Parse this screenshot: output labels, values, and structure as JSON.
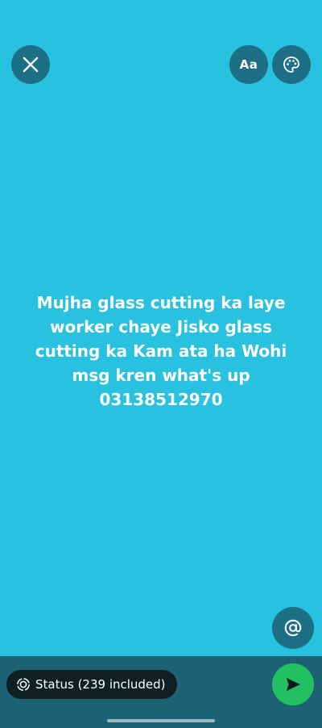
{
  "toolbar": {
    "close_icon": "close-icon",
    "font_button_label": "Aa",
    "palette_icon": "palette-icon"
  },
  "status": {
    "text": "Mujha glass cutting ka laye\nworker chaye Jisko glass\ncutting ka Kam ata ha Wohi\nmsg kren what's up\n03138512970",
    "background_color": "#28c1df",
    "text_color": "#ffffff"
  },
  "mention": {
    "icon": "at-sign-icon"
  },
  "footer": {
    "audience_label": "Status (239 included)",
    "audience_icon": "status-ring-icon",
    "send_icon": "send-icon",
    "send_color": "#21c063"
  }
}
